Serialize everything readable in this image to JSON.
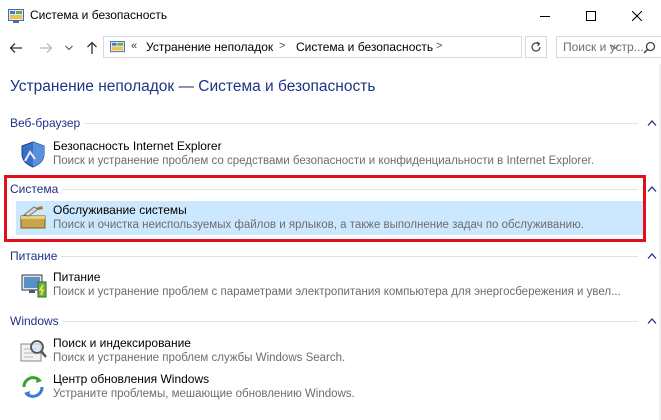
{
  "window": {
    "title": "Система и безопасность",
    "icon": "control-panel-icon",
    "controls": [
      "minimize-icon",
      "maximize-icon",
      "close-icon"
    ]
  },
  "nav": {
    "back_icon": "arrow-left-icon",
    "forward_icon": "arrow-right-icon",
    "recent_icon": "chevron-down-icon",
    "up_icon": "arrow-up-icon",
    "address": {
      "overflow": "«",
      "crumbs": [
        "Устранение неполадок",
        "Система и безопасность"
      ]
    },
    "refresh_icon": "refresh-icon",
    "search_placeholder": "Поиск и устр..."
  },
  "page_title": "Устранение неполадок — Система и безопасность",
  "groups": [
    {
      "header": "Веб-браузер",
      "items": [
        {
          "icon": "shield-icon",
          "title": "Безопасность Internet Explorer",
          "description": "Поиск и устранение проблем со средствами безопасности и конфиденциальности в Internet Explorer."
        }
      ]
    },
    {
      "header": "Система",
      "items": [
        {
          "icon": "maintenance-icon",
          "title": "Обслуживание системы",
          "description": "Поиск и очистка неиспользуемых файлов и ярлыков, а также выполнение задач по обслуживанию.",
          "selected": true
        }
      ]
    },
    {
      "header": "Питание",
      "items": [
        {
          "icon": "power-icon",
          "title": "Питание",
          "description": "Поиск и устранение проблем с параметрами электропитания компьютера для энергосбережения и увел..."
        }
      ]
    },
    {
      "header": "Windows",
      "items": [
        {
          "icon": "search-indexing-icon",
          "title": "Поиск и индексирование",
          "description": "Поиск и устранение проблем службы Windows Search."
        },
        {
          "icon": "windows-update-icon",
          "title": "Центр обновления Windows",
          "description": "Устраните проблемы, мешающие обновлению Windows."
        }
      ]
    }
  ],
  "colors": {
    "heading": "#1e3287",
    "selection": "#cce8ff",
    "highlight_frame": "#e0101d",
    "muted_text": "#6d6d6d"
  }
}
